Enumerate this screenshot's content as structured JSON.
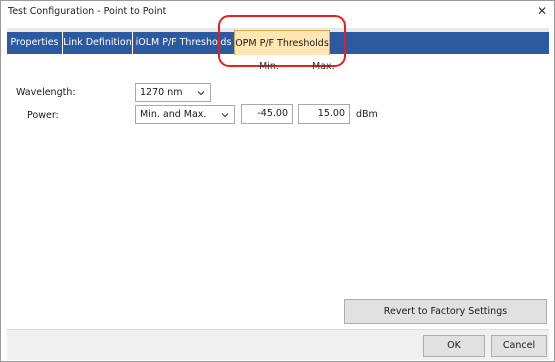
{
  "window": {
    "title": "Test Configuration - Point to Point",
    "close_glyph": "✕"
  },
  "tabs": [
    {
      "label": "Properties",
      "active": false
    },
    {
      "label": "Link Definition",
      "active": false
    },
    {
      "label": "iOLM P/F Thresholds",
      "active": false
    },
    {
      "label": "OPM P/F Thresholds",
      "active": true
    }
  ],
  "columns": {
    "min": "Min.",
    "max": "Max."
  },
  "wavelength": {
    "label": "Wavelength:",
    "value": "1270 nm"
  },
  "power": {
    "label": "Power:",
    "mode": "Min. and Max.",
    "min": "-45.00",
    "max": "15.00",
    "unit": "dBm"
  },
  "buttons": {
    "revert": "Revert to Factory Settings",
    "ok": "OK",
    "cancel": "Cancel"
  },
  "colors": {
    "tab_band": "#2c5aa0",
    "active_tab": "#ffe6b3",
    "highlight": "#e61f1f"
  }
}
